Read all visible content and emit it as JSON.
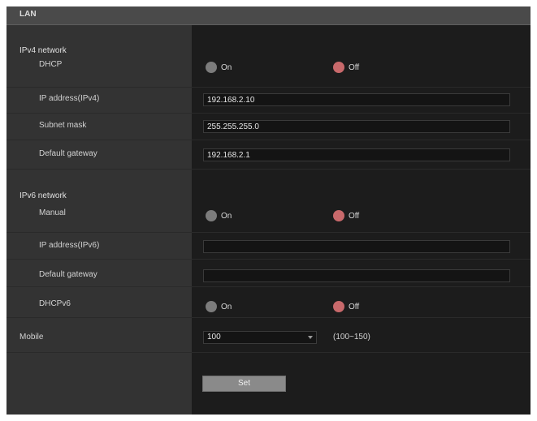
{
  "title": "LAN",
  "ipv4": {
    "section_label": "IPv4 network",
    "dhcp_label": "DHCP",
    "dhcp_on": "On",
    "dhcp_off": "Off",
    "ip_label": "IP address(IPv4)",
    "ip_value": "192.168.2.10",
    "subnet_label": "Subnet mask",
    "subnet_value": "255.255.255.0",
    "gateway_label": "Default gateway",
    "gateway_value": "192.168.2.1"
  },
  "ipv6": {
    "section_label": "IPv6 network",
    "manual_label": "Manual",
    "manual_on": "On",
    "manual_off": "Off",
    "ip_label": "IP address(IPv6)",
    "ip_value": "",
    "gateway_label": "Default gateway",
    "gateway_value": "",
    "dhcpv6_label": "DHCPv6",
    "dhcpv6_on": "On",
    "dhcpv6_off": "Off"
  },
  "mtu": {
    "label": "Mobile",
    "value": "100",
    "range": "(100~150)"
  },
  "set_button": "Set",
  "colors": {
    "radio_selected": "#c8696b",
    "radio_unselected": "#7c7c7c",
    "title_bar": "#4a4a4a"
  }
}
